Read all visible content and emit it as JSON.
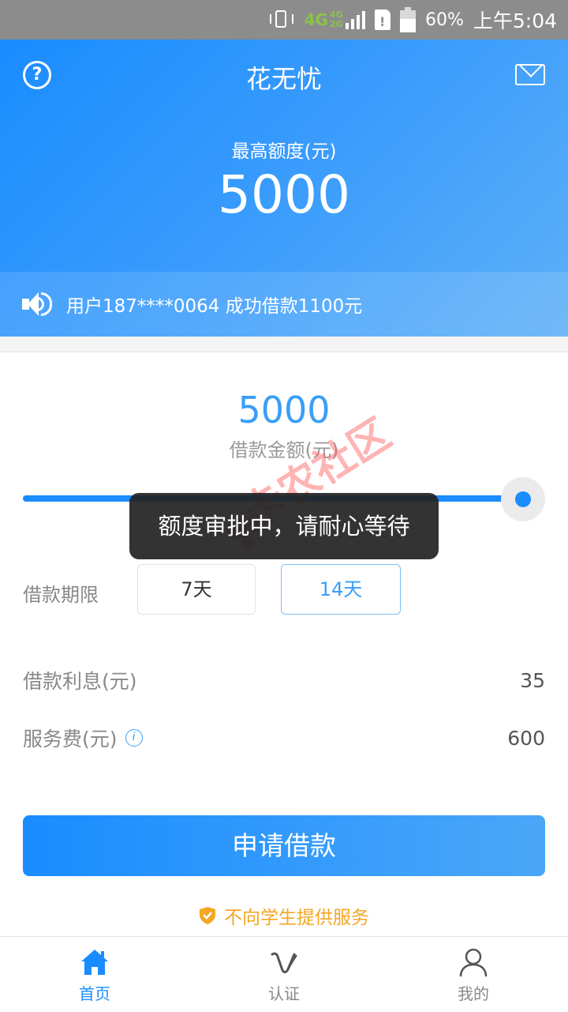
{
  "status_bar": {
    "network": "4G",
    "network_secondary": "4G 2G",
    "battery": "60%",
    "battery_level": 0.6,
    "time": "上午5:04"
  },
  "header": {
    "title": "花无忧",
    "help_icon": "help-circle-icon",
    "mail_icon": "mail-icon",
    "limit_label": "最高额度(元)",
    "limit_value": "5000"
  },
  "notice": {
    "icon": "speaker-icon",
    "text": "用户187****0064 成功借款1100元"
  },
  "loan": {
    "amount": "5000",
    "amount_label": "借款金额(元)",
    "slider_level": 1.0,
    "term_label": "借款期限",
    "terms": [
      "7天",
      "14天"
    ],
    "selected_term": "14天",
    "interest_label": "借款利息(元)",
    "interest_value": "35",
    "service_label": "服务费(元)",
    "service_value": "600"
  },
  "apply_button": "申请借款",
  "student_notice": "不向学生提供服务",
  "toast": "额度审批中，请耐心等待",
  "watermark": "卡农社区",
  "tabs": [
    {
      "label": "首页",
      "icon": "home-icon",
      "active": true
    },
    {
      "label": "认证",
      "icon": "verify-icon",
      "active": false
    },
    {
      "label": "我的",
      "icon": "user-icon",
      "active": false
    }
  ],
  "colors": {
    "primary": "#1a8cff",
    "accent_light": "#3a9ef7",
    "warning": "#f5a623",
    "status_bar": "#8c8c8c"
  }
}
